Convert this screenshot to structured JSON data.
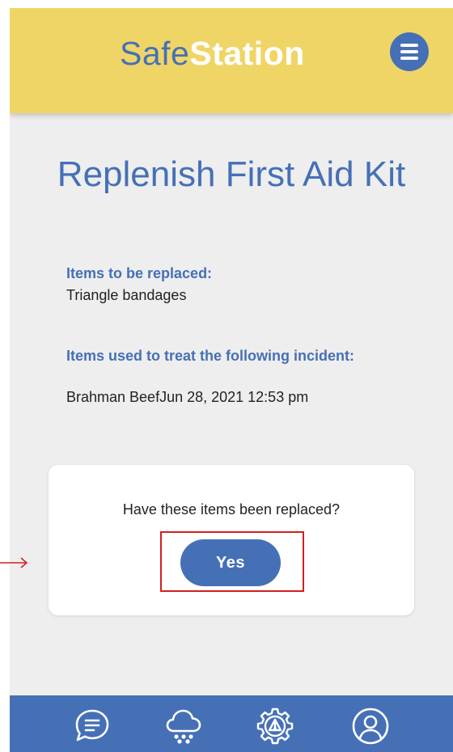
{
  "header": {
    "logo_part1": "Safe",
    "logo_part2": "Station",
    "menu_icon": "hamburger-menu-icon"
  },
  "page": {
    "title": "Replenish First Aid Kit"
  },
  "items_to_replace": {
    "label": "Items to be replaced:",
    "value": "Triangle bandages"
  },
  "incident": {
    "label": "Items used to treat the following incident:",
    "value": "Brahman BeefJun 28, 2021 12:53 pm"
  },
  "confirm_card": {
    "question": "Have these items been replaced?",
    "yes_label": "Yes"
  },
  "bottom_nav": {
    "items": [
      {
        "icon": "chat-bubble-icon"
      },
      {
        "icon": "weather-cloud-icon"
      },
      {
        "icon": "hazard-gear-icon"
      },
      {
        "icon": "user-profile-icon"
      }
    ]
  },
  "colors": {
    "header_bg": "#efd566",
    "brand_blue": "#4670b6",
    "page_bg": "#eeeeee",
    "highlight": "#d21f1f"
  }
}
